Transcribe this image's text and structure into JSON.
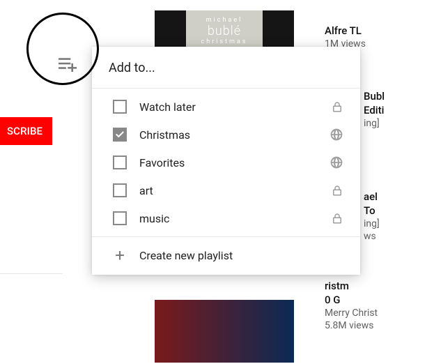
{
  "subscribe_label": "SCRIBE",
  "dialog": {
    "title": "Add to...",
    "create_label": "Create new playlist",
    "playlists": [
      {
        "name": "Watch later",
        "checked": false,
        "privacy": "private"
      },
      {
        "name": "Christmas",
        "checked": true,
        "privacy": "public"
      },
      {
        "name": "Favorites",
        "checked": false,
        "privacy": "public"
      },
      {
        "name": "art",
        "checked": false,
        "privacy": "private"
      },
      {
        "name": "music",
        "checked": false,
        "privacy": "private"
      }
    ]
  },
  "sidebar_videos": [
    {
      "title_fragment": "Alfre TL",
      "meta": "1M views"
    },
    {
      "title_fragment": "Bubl",
      "line2": "Editi",
      "meta": "ing]"
    },
    {
      "title_fragment": "ael",
      "line2": "To",
      "meta1": "ing]",
      "meta2": "ws"
    },
    {
      "title_fragment": "ristm",
      "line2": "0 G",
      "meta1": "Merry Christ",
      "meta2": "5.8M views"
    }
  ],
  "thumb_label": "bublé\nchristmas"
}
